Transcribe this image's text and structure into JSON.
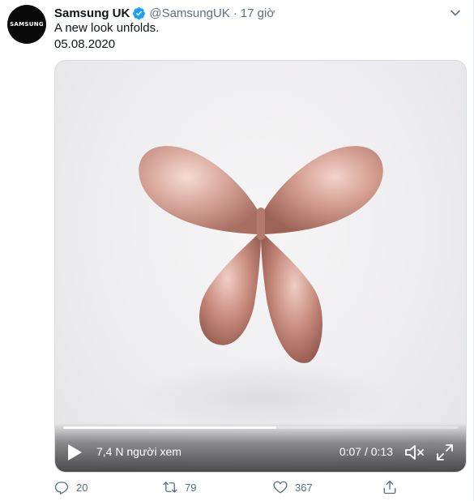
{
  "avatar": {
    "text": "SAMSUNG"
  },
  "author": {
    "display_name": "Samsung UK",
    "handle": "@SamsungUK",
    "separator": "·",
    "time": "17 giờ",
    "verified_color": "#1da1f2"
  },
  "tweet": {
    "line1": "A new look unfolds.",
    "line2": "05.08.2020"
  },
  "video": {
    "views": "7,4 N người xem",
    "timecode": "0:07 / 0:13",
    "progress": 0.54,
    "accent": "#c9968d"
  },
  "actions": {
    "reply_count": "20",
    "retweet_count": "79",
    "like_count": "367"
  },
  "icons": [
    "verified-badge-icon",
    "chevron-down-icon",
    "play-icon",
    "volume-muted-icon",
    "fullscreen-icon",
    "reply-icon",
    "retweet-icon",
    "like-icon",
    "share-icon"
  ]
}
